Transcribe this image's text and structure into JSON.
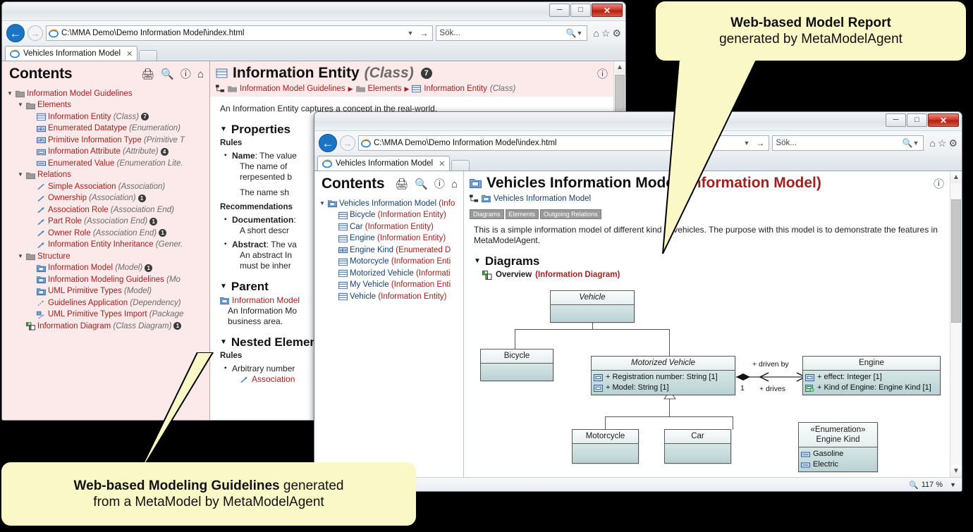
{
  "window1": {
    "address": "C:\\MMA Demo\\Demo Information Model\\index.html",
    "search_placeholder": "Sök...",
    "tab_title": "Vehicles Information Model",
    "contents_title": "Contents",
    "icons": {
      "print": "printer-icon",
      "search": "search-icon",
      "help": "help-icon",
      "home": "home-icon"
    },
    "tree": [
      {
        "depth": 0,
        "twisty": "down",
        "icon": "folder",
        "name": "Information Model Guidelines",
        "type": "",
        "count": ""
      },
      {
        "depth": 1,
        "twisty": "down",
        "icon": "folder",
        "name": "Elements",
        "type": "",
        "count": ""
      },
      {
        "depth": 2,
        "twisty": "",
        "icon": "class",
        "name": "Information Entity",
        "type": "(Class)",
        "count": "7"
      },
      {
        "depth": 2,
        "twisty": "",
        "icon": "enum",
        "name": "Enumerated Datatype",
        "type": "(Enumeration)",
        "count": ""
      },
      {
        "depth": 2,
        "twisty": "",
        "icon": "prim",
        "name": "Primitive Information Type",
        "type": "(Primitive T",
        "count": ""
      },
      {
        "depth": 2,
        "twisty": "",
        "icon": "attr",
        "name": "Information Attribute",
        "type": "(Attribute)",
        "count": "4"
      },
      {
        "depth": 2,
        "twisty": "",
        "icon": "lit",
        "name": "Enumerated Value",
        "type": "(Enumeration Lite.",
        "count": ""
      },
      {
        "depth": 1,
        "twisty": "down",
        "icon": "folder",
        "name": "Relations",
        "type": "",
        "count": ""
      },
      {
        "depth": 2,
        "twisty": "",
        "icon": "assoc",
        "name": "Simple Association",
        "type": "(Association)",
        "count": ""
      },
      {
        "depth": 2,
        "twisty": "",
        "icon": "assoc",
        "name": "Ownership",
        "type": "(Association)",
        "count": "1"
      },
      {
        "depth": 2,
        "twisty": "",
        "icon": "aend",
        "name": "Association Role",
        "type": "(Association End)",
        "count": ""
      },
      {
        "depth": 2,
        "twisty": "",
        "icon": "aend",
        "name": "Part Role",
        "type": "(Association End)",
        "count": "1"
      },
      {
        "depth": 2,
        "twisty": "",
        "icon": "aend",
        "name": "Owner Role",
        "type": "(Association End)",
        "count": "1"
      },
      {
        "depth": 2,
        "twisty": "",
        "icon": "gen",
        "name": "Information Entity Inheritance",
        "type": "(Gener.",
        "count": ""
      },
      {
        "depth": 1,
        "twisty": "down",
        "icon": "folder",
        "name": "Structure",
        "type": "",
        "count": ""
      },
      {
        "depth": 2,
        "twisty": "",
        "icon": "model",
        "name": "Information Model",
        "type": "(Model)",
        "count": "1"
      },
      {
        "depth": 2,
        "twisty": "",
        "icon": "model",
        "name": "Information Modeling Guidelines",
        "type": "(Mo",
        "count": ""
      },
      {
        "depth": 2,
        "twisty": "",
        "icon": "model",
        "name": "UML Primitive Types",
        "type": "(Model)",
        "count": ""
      },
      {
        "depth": 2,
        "twisty": "",
        "icon": "dep",
        "name": "Guidelines Application",
        "type": "(Dependency)",
        "count": ""
      },
      {
        "depth": 2,
        "twisty": "",
        "icon": "imp",
        "name": "UML Primitive Types Import",
        "type": "(Package",
        "count": ""
      },
      {
        "depth": 1,
        "twisty": "",
        "icon": "diagram",
        "name": "Information Diagram",
        "type": "(Class Diagram)",
        "count": "1"
      }
    ],
    "detail": {
      "icon": "class-icon",
      "title": "Information Entity",
      "title_type": "(Class)",
      "title_count": "7",
      "help_icon": "help-icon",
      "breadcrumb": [
        {
          "icon": "hierarchy-icon",
          "label": ""
        },
        {
          "icon": "folder-icon",
          "label": "Information Model Guidelines"
        },
        {
          "icon": "folder-icon",
          "label": "Elements"
        },
        {
          "icon": "class-icon",
          "label": "Information Entity",
          "type": "(Class)"
        }
      ],
      "intro": "An Information Entity captures a concept in the real-world.",
      "sections": [
        {
          "heading": "Properties",
          "sub1": "Rules",
          "rules": [
            {
              "term": "Name",
              "text": ": The value",
              "lines": [
                "The name of",
                "rerpesented b",
                "",
                "The name sh"
              ]
            }
          ],
          "sub2": "Recommendations",
          "recs": [
            {
              "term": "Documentation",
              "text": ":",
              "lines": [
                "A short descr"
              ]
            },
            {
              "term": "Abstract",
              "text": ": The va",
              "lines": [
                "An abstract In",
                "must be inher"
              ]
            }
          ]
        },
        {
          "heading": "Parent",
          "link": "Information Model",
          "lines": [
            "An Information Mo",
            "business area."
          ]
        },
        {
          "heading": "Nested Element",
          "sub1": "Rules",
          "rules": [
            {
              "term": "",
              "text": "Arbitrary number",
              "lines": [
                "Association"
              ]
            }
          ]
        }
      ]
    }
  },
  "window2": {
    "address": "C:\\MMA Demo\\Demo Information Model\\index.html",
    "search_placeholder": "Sök...",
    "tab_title": "Vehicles Information Model",
    "contents_title": "Contents",
    "tree": [
      {
        "depth": 0,
        "twisty": "down",
        "icon": "model",
        "name": "Vehicles Information Model",
        "type": "(Info"
      },
      {
        "depth": 1,
        "twisty": "",
        "icon": "class",
        "name": "Bicycle",
        "type": "(Information Entity)"
      },
      {
        "depth": 1,
        "twisty": "",
        "icon": "class",
        "name": "Car",
        "type": "(Information Entity)"
      },
      {
        "depth": 1,
        "twisty": "",
        "icon": "class",
        "name": "Engine",
        "type": "(Information Entity)"
      },
      {
        "depth": 1,
        "twisty": "",
        "icon": "enum",
        "name": "Engine Kind",
        "type": "(Enumerated D"
      },
      {
        "depth": 1,
        "twisty": "",
        "icon": "class",
        "name": "Motorcycle",
        "type": "(Information Enti"
      },
      {
        "depth": 1,
        "twisty": "",
        "icon": "class",
        "name": "Motorized Vehicle",
        "type": "(Informati"
      },
      {
        "depth": 1,
        "twisty": "",
        "icon": "class",
        "name": "My Vehicle",
        "type": "(Information Enti"
      },
      {
        "depth": 1,
        "twisty": "",
        "icon": "class",
        "name": "Vehicle",
        "type": "(Information Entity)"
      }
    ],
    "detail": {
      "title": "Vehicles Information Model",
      "title_type": "(Information Model)",
      "breadcrumb_label": "Vehicles Information Model",
      "chips": [
        "Diagrams",
        "Elements",
        "Outgoing Relations"
      ],
      "intro_line1": "This is a simple information model of different kind of vehicles. The purpose with this model is to demonstrate the features in",
      "intro_line2": "MetaModelAgent.",
      "diagrams_heading": "Diagrams",
      "diagram_name": "Overview",
      "diagram_type": "(Information Diagram)"
    },
    "status": {
      "zoom": "117 %",
      "zoom_icon": "zoom-icon",
      "dropdown": "chevron-down-icon"
    }
  },
  "diagram": {
    "classes": [
      {
        "id": "vehicle",
        "name": "Vehicle",
        "italic": true,
        "attrs": []
      },
      {
        "id": "bicycle",
        "name": "Bicycle",
        "italic": false,
        "attrs": []
      },
      {
        "id": "motorized",
        "name": "Motorized Vehicle",
        "italic": true,
        "attrs": [
          "+ Registration number: String [1]",
          "+ Model: String [1]"
        ]
      },
      {
        "id": "engine",
        "name": "Engine",
        "italic": false,
        "attrs": [
          "+ effect: Integer [1]",
          "+ Kind of Engine: Engine Kind [1]"
        ]
      },
      {
        "id": "motorcycle",
        "name": "Motorcycle",
        "italic": false,
        "attrs": []
      },
      {
        "id": "car",
        "name": "Car",
        "italic": false,
        "attrs": []
      }
    ],
    "enumeration": {
      "stereotype": "«Enumeration»",
      "name": "Engine Kind",
      "literals": [
        "Gasoline",
        "Electric"
      ]
    },
    "association": {
      "role_target": "+ driven by",
      "role_source": "+ drives",
      "multiplicity": "1"
    }
  },
  "callouts": {
    "top": {
      "line1": "Web-based Model Report",
      "line2": "generated by MetaModelAgent"
    },
    "bottom": {
      "line1_bold": "Web-based Modeling Guidelines",
      "line1_rest": " generated",
      "line2": "from a MetaModel by MetaModelAgent"
    }
  },
  "colors": {
    "accent_red": "#a32020",
    "tree_blue": "#17406e",
    "callout_bg": "#fbf8c8",
    "contents_pink": "#fce9e9",
    "uml_fill": "#b9d2d3"
  }
}
